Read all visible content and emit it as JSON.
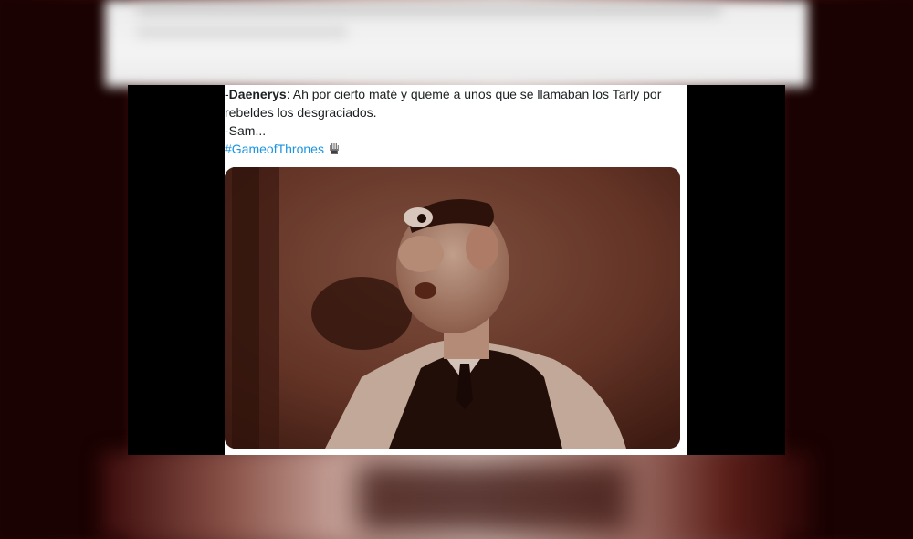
{
  "tweet": {
    "line1_prefix": "-",
    "line1_speaker": "Daenerys",
    "line1_rest": ": Ah por cierto maté y quemé a unos que se llamaban los Tarly por",
    "line2": "rebeldes los desgraciados.",
    "line3": "-Sam...",
    "hashtag": "#GameofThrones",
    "hashtag_icon": "iron-throne-icon",
    "media_description": "gif-still"
  },
  "colors": {
    "hashtag": "#1b95e0",
    "text": "#1c2022",
    "media_tint": "#6b3a2d"
  }
}
